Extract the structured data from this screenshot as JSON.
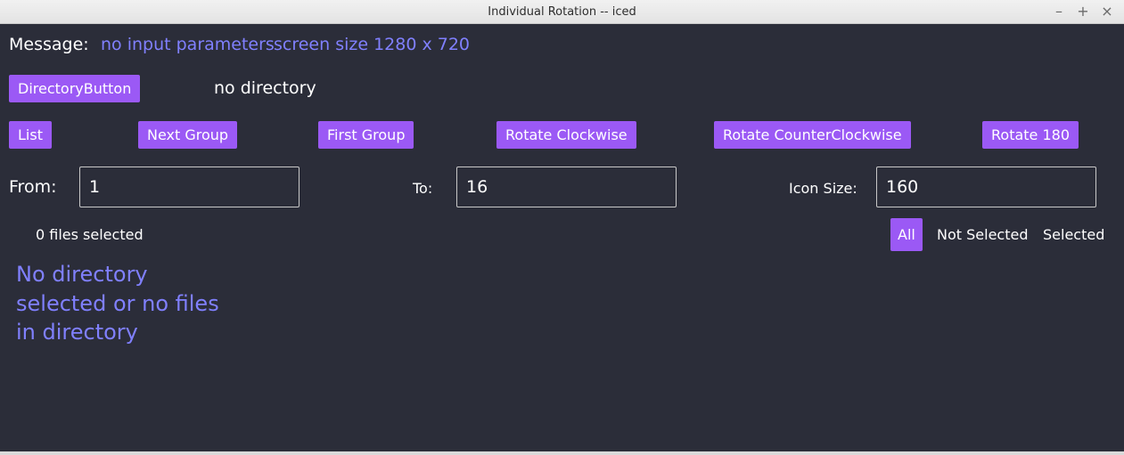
{
  "window": {
    "title": "Individual Rotation -- iced",
    "minimize_glyph": "–",
    "maximize_glyph": "+",
    "close_glyph": "×"
  },
  "message": {
    "label": "Message:",
    "text1": "no input parameters",
    "text2": "screen size 1280 x 720"
  },
  "directory": {
    "button_label": "DirectoryButton",
    "status": "no directory"
  },
  "toolbar": {
    "list": "List",
    "next_group": "Next Group",
    "first_group": "First Group",
    "rotate_cw": "Rotate Clockwise",
    "rotate_ccw": "Rotate CounterClockwise",
    "rotate_180": "Rotate 180"
  },
  "range": {
    "from_label": "From:",
    "from_value": "1",
    "to_label": "To:",
    "to_value": "16",
    "icon_size_label": "Icon Size:",
    "icon_size_value": "160"
  },
  "selection": {
    "count_text": "0 files selected",
    "filters": [
      "All",
      "Not Selected",
      "Selected"
    ],
    "active_filter": "All"
  },
  "content": {
    "empty_line1": "No directory",
    "empty_line2": "selected or no files",
    "empty_line3": "in directory"
  },
  "colors": {
    "background": "#2b2d39",
    "accent_button": "#9b59f5",
    "accent_text": "#8080ff"
  }
}
